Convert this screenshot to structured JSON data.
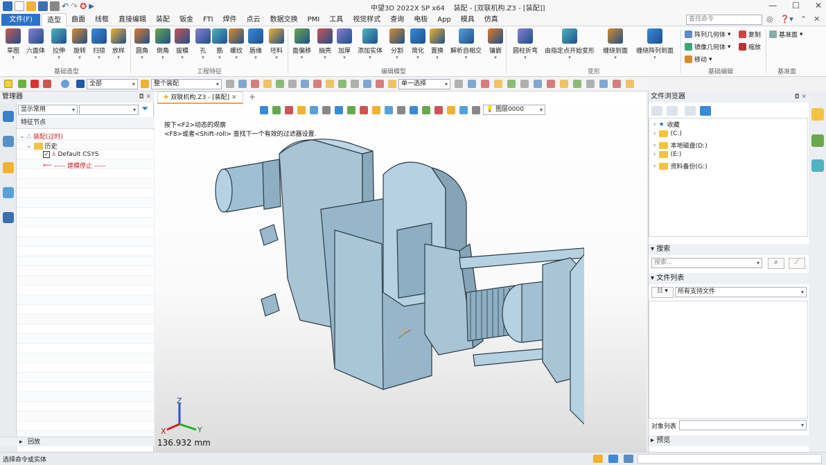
{
  "app": {
    "title": "中望3D 2022X SP x64",
    "doc_title": "装配 - [双联机构.Z3 - [装配]]"
  },
  "menu": {
    "file": "文件(F)",
    "tabs": [
      "造型",
      "曲面",
      "线框",
      "直接编辑",
      "装配",
      "钣金",
      "FTI",
      "焊件",
      "点云",
      "数据交换",
      "PMI",
      "工具",
      "视觉样式",
      "查询",
      "电极",
      "App",
      "模具",
      "仿真"
    ],
    "search_placeholder": "查找命令"
  },
  "ribbon": {
    "basic": [
      "草图",
      "六面体",
      "拉伸",
      "旋转",
      "扫掠",
      "放样"
    ],
    "basic_group": "基础造型",
    "eng": [
      "圆角",
      "倒角",
      "拔模",
      "孔",
      "筋",
      "螺纹",
      "唇缘",
      "坯料"
    ],
    "eng_group": "工程特征",
    "edit": [
      "面偏移",
      "抽壳",
      "加厚",
      "添加实体",
      "分割",
      "简化",
      "置换",
      "解析自相交",
      "镶嵌"
    ],
    "edit_group": "编辑模型",
    "deform": [
      "圆柱折弯",
      "由指定点开始变形",
      "缠绕到面",
      "缠绕阵列到面"
    ],
    "deform_group": "变形",
    "basic_edit": {
      "pattern": "阵列几何体",
      "mirror": "镜像几何体",
      "move": "移动",
      "copy": "复制",
      "scale": "缩放"
    },
    "basic_edit_group": "基础编辑",
    "datum": "基准面",
    "datum_group": "基准面"
  },
  "toolbar2": {
    "filter": "全部",
    "scope": "整个装配",
    "select_mode": "单一选择"
  },
  "manager": {
    "title": "管理器",
    "filter": "显示常用",
    "col_header": "特征节点",
    "tree": {
      "root": "装配(过时)",
      "history": "历史",
      "csys": "Default CSYS",
      "stop": "----- 建模停止 -----"
    },
    "footer": "回放"
  },
  "viewport": {
    "tab": "双联机构.Z3 - [装配]",
    "hint1": "按下<F2>动态的观察",
    "hint2": "<F8>或者<Shift-roll> 查找下一个有效的过滤器设置.",
    "layer": "图层0000",
    "measure": "136.932 mm",
    "axes": {
      "x": "X",
      "y": "Y",
      "z": "Z"
    }
  },
  "filebrowser": {
    "title": "文件浏览器",
    "items": [
      "收藏",
      "(C:)",
      "本地磁盘(D:)",
      "(E:)",
      "资料备份(G:)"
    ],
    "search_title": "搜索",
    "search_placeholder": "搜索...",
    "filelist_title": "文件列表",
    "filetype": "所有支持文件",
    "objlist": "对象列表",
    "preview": "预览"
  },
  "status": {
    "text": "选择命令或实体"
  }
}
